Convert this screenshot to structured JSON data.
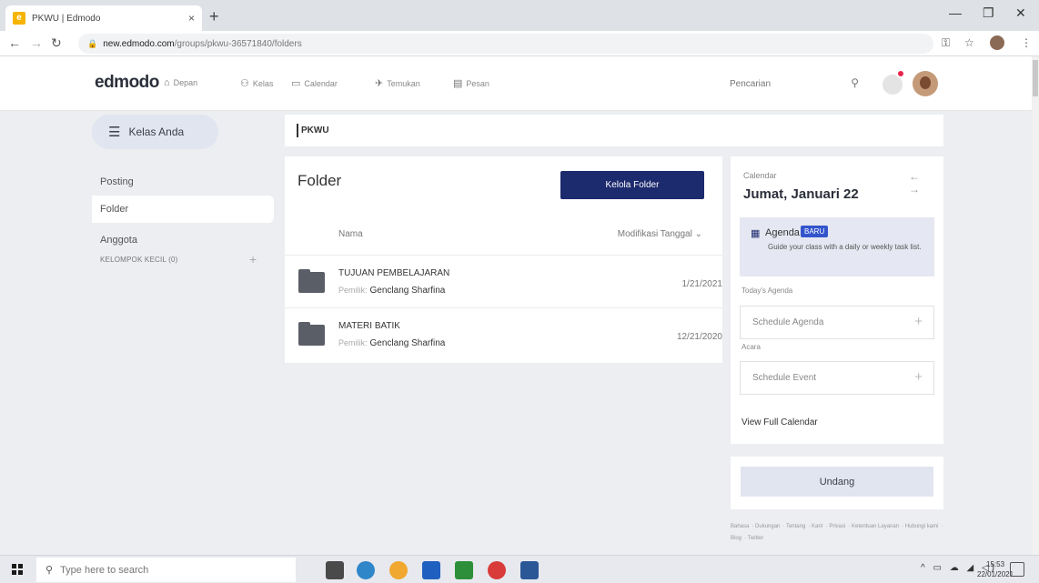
{
  "browser": {
    "tab_title": "PKWU | Edmodo",
    "tab_favicon": "e",
    "tab_close": "×",
    "new_tab": "+",
    "url_host": "new.edmodo.com",
    "url_path": "/groups/pkwu-36571840/folders"
  },
  "nav": {
    "logo": "edmodo",
    "items": [
      {
        "label": "Depan",
        "icon": "home-icon"
      },
      {
        "label": "Kelas",
        "icon": "classes-icon"
      },
      {
        "label": "Calendar",
        "icon": "calendar-icon"
      },
      {
        "label": "Temukan",
        "icon": "discover-icon"
      },
      {
        "label": "Pesan",
        "icon": "message-icon"
      }
    ],
    "search_placeholder": "Pencarian"
  },
  "sidebar": {
    "kelas_button": "Kelas Anda",
    "items": [
      {
        "label": "Posting"
      },
      {
        "label": "Folder"
      },
      {
        "label": "Anggota"
      }
    ],
    "small_groups": "KELOMPOK KECIL (0)",
    "small_groups_add": "+"
  },
  "breadcrumb": "PKWU",
  "folders": {
    "title": "Folder",
    "manage_button": "Kelola Folder",
    "col_name": "Nama",
    "col_modified": "Modifikasi Tanggal ⌄",
    "owner_label": "Pemilik:",
    "rows": [
      {
        "name": "TUJUAN PEMBELAJARAN",
        "owner": "Genclang Sharfina",
        "date": "1/21/2021"
      },
      {
        "name": "MATERI BATIK",
        "owner": "Genclang Sharfina",
        "date": "12/21/2020"
      }
    ]
  },
  "calendar": {
    "label": "Calendar",
    "arrows": "← →",
    "date": "Jumat, Januari 22",
    "agenda_title": "Agenda",
    "agenda_badge": "BARU",
    "agenda_desc": "Guide your class with a daily or weekly task list.",
    "todays_agenda": "Today's Agenda",
    "schedule_agenda": "Schedule Agenda",
    "acara": "Acara",
    "schedule_event": "Schedule Event",
    "view_full": "View Full Calendar"
  },
  "invite_button": "Undang",
  "footer": {
    "links": [
      "Bahasa",
      "Dukungan",
      "Tentang",
      "Karir",
      "Privasi",
      "Ketentuan Layanan",
      "Hubungi kami",
      "Blog",
      "Twitter"
    ]
  },
  "taskbar": {
    "search_placeholder": "Type here to search",
    "time": "15:53",
    "date": "22/01/2021",
    "tray": "^ ▭ ☁ ◢ ◁)",
    "app_colors": [
      "#4a4a4a",
      "#2f86c9",
      "#f0a830",
      "#1f5fbf",
      "#2d8f3a",
      "#d93b3b",
      "#2b5797"
    ]
  }
}
